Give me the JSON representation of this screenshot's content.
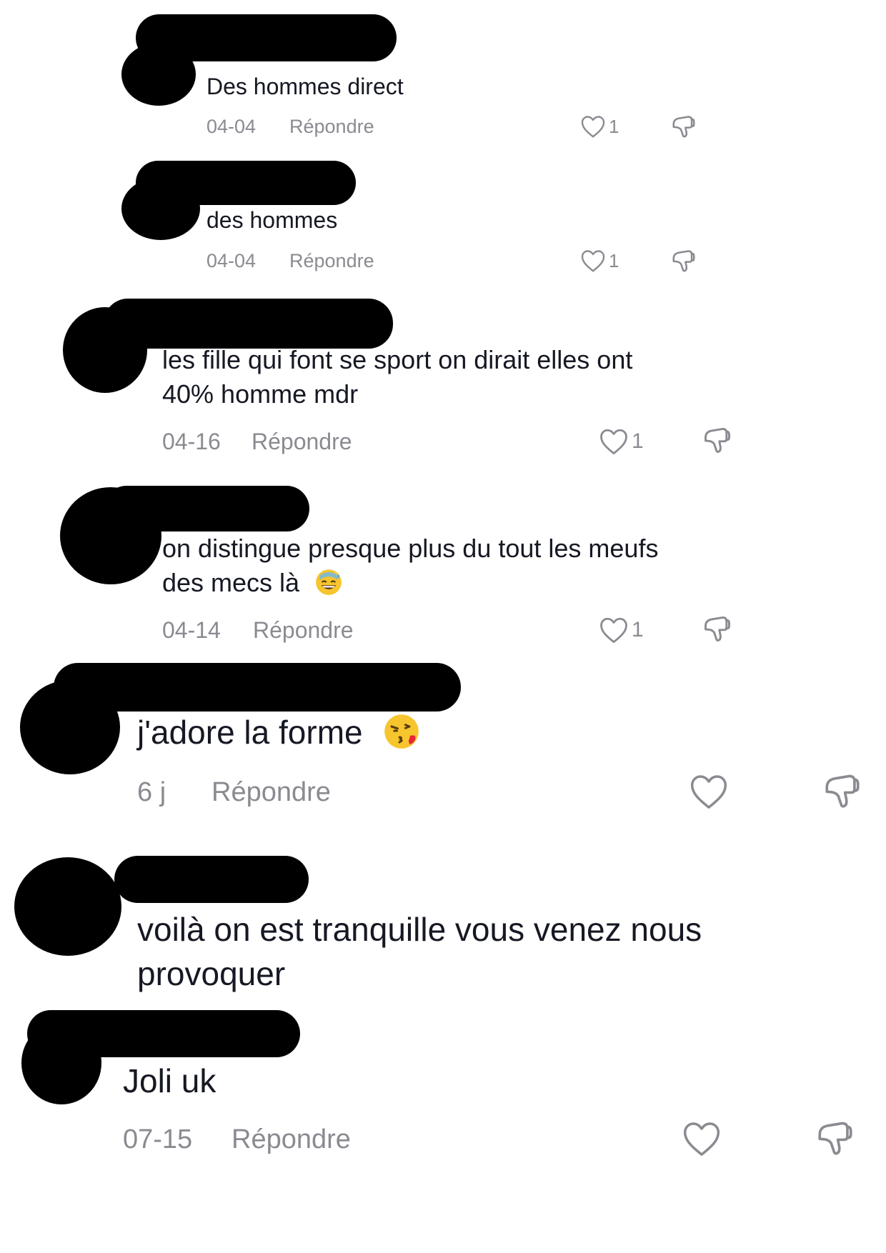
{
  "comments": [
    {
      "text": "Des hommes direct",
      "date": "04-04",
      "reply": "Répondre",
      "likes": "1"
    },
    {
      "text": "des hommes",
      "date": "04-04",
      "reply": "Répondre",
      "likes": "1"
    },
    {
      "lines": [
        "les fille qui font se sport on dirait elles ont",
        "40% homme mdr"
      ],
      "date": "04-16",
      "reply": "Répondre",
      "likes": "1"
    },
    {
      "lines": [
        "on distingue presque plus du tout les meufs",
        "des mecs là"
      ],
      "emoji": "grinning-sweat-emoji",
      "date": "04-14",
      "reply": "Répondre",
      "likes": "1"
    },
    {
      "text": "j'adore la forme",
      "emoji": "face-blowing-kiss-emoji",
      "date": "6 j",
      "reply": "Répondre"
    },
    {
      "lines": [
        "voilà on est tranquille vous venez nous",
        "provoquer"
      ]
    },
    {
      "text": "Joli uk",
      "date": "07-15",
      "reply": "Répondre"
    }
  ],
  "icons": {
    "like": "heart-outline-icon",
    "dislike": "thumbs-down-icon"
  }
}
